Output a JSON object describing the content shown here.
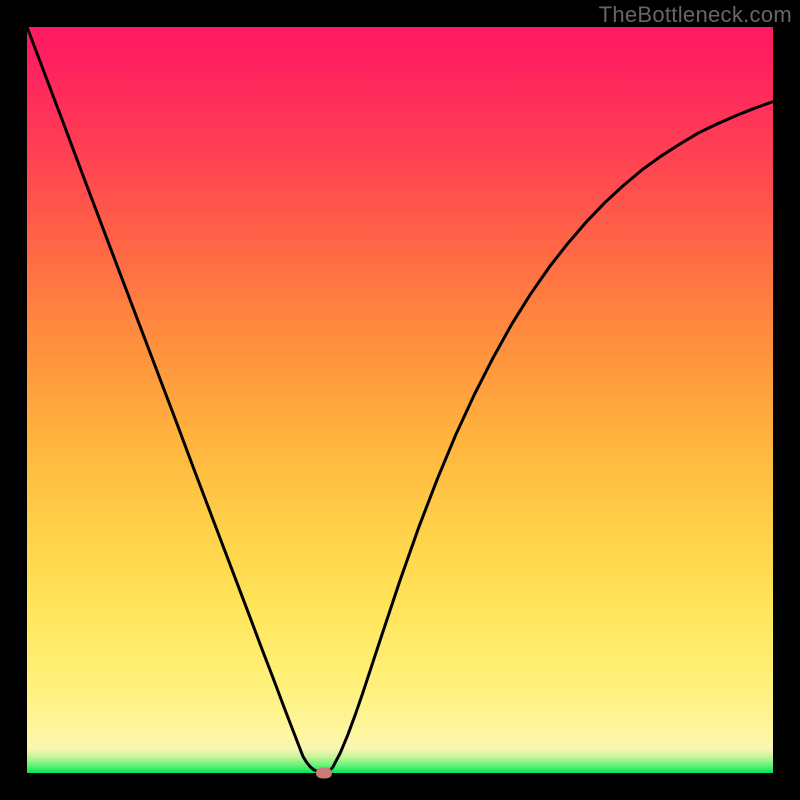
{
  "watermark": "TheBottleneck.com",
  "chart_data": {
    "type": "line",
    "title": "",
    "xlabel": "",
    "ylabel": "",
    "xlim": [
      0,
      1
    ],
    "ylim": [
      0,
      1
    ],
    "x": [
      0.0,
      0.025,
      0.05,
      0.075,
      0.1,
      0.125,
      0.15,
      0.175,
      0.2,
      0.225,
      0.25,
      0.275,
      0.3,
      0.315,
      0.33,
      0.345,
      0.355,
      0.365,
      0.37,
      0.375,
      0.38,
      0.385,
      0.39,
      0.395,
      0.4,
      0.405,
      0.41,
      0.42,
      0.43,
      0.44,
      0.45,
      0.475,
      0.5,
      0.525,
      0.55,
      0.575,
      0.6,
      0.625,
      0.65,
      0.675,
      0.7,
      0.725,
      0.75,
      0.775,
      0.8,
      0.825,
      0.85,
      0.875,
      0.9,
      0.925,
      0.95,
      0.975,
      1.0
    ],
    "values": [
      1.0,
      0.934,
      0.868,
      0.801,
      0.735,
      0.669,
      0.603,
      0.537,
      0.471,
      0.404,
      0.338,
      0.272,
      0.206,
      0.166,
      0.127,
      0.087,
      0.061,
      0.035,
      0.022,
      0.014,
      0.008,
      0.004,
      0.002,
      0.001,
      0.0,
      0.002,
      0.008,
      0.027,
      0.051,
      0.078,
      0.107,
      0.183,
      0.258,
      0.329,
      0.394,
      0.454,
      0.508,
      0.557,
      0.602,
      0.642,
      0.678,
      0.71,
      0.739,
      0.765,
      0.788,
      0.809,
      0.827,
      0.843,
      0.858,
      0.87,
      0.881,
      0.891,
      0.9
    ],
    "marker": {
      "x": 0.398,
      "y": 0.0
    }
  },
  "colors": {
    "curve": "#000000",
    "marker": "#cc7a76",
    "frame": "#000000"
  }
}
